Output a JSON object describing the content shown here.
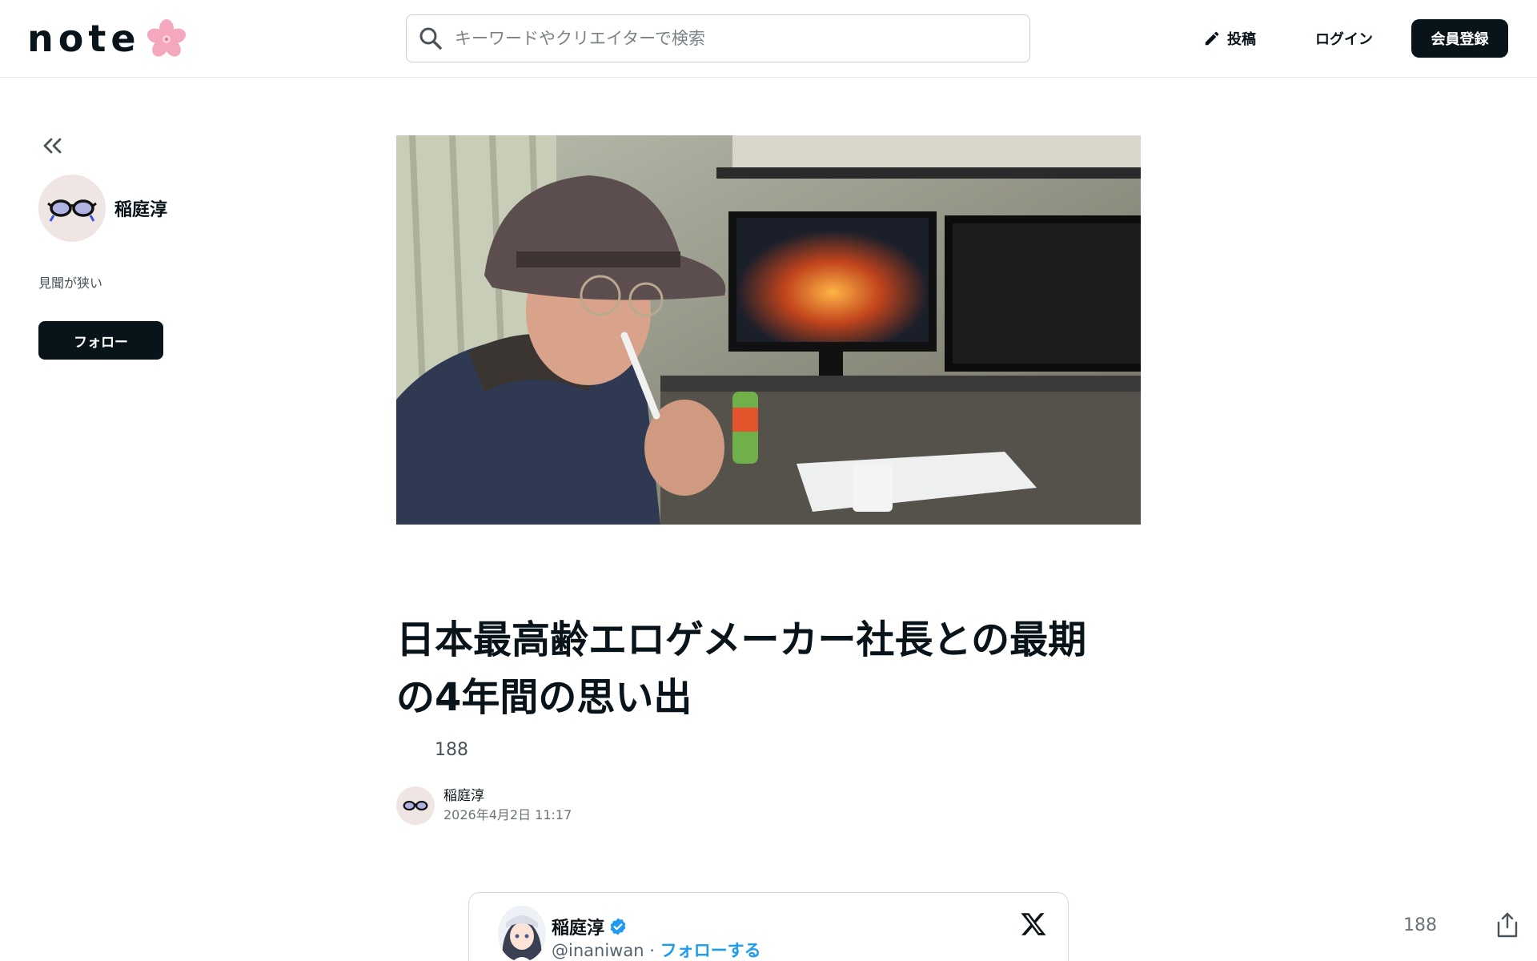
{
  "header": {
    "logo_text": "note",
    "search_placeholder": "キーワードやクリエイターで検索",
    "post_label": "投稿",
    "login_label": "ログイン",
    "signup_label": "会員登録"
  },
  "sidebar": {
    "creator_name": "稲庭淳",
    "bio": "見聞が狭い",
    "follow_label": "フォロー"
  },
  "article": {
    "title_line1": "日本最高齢エロゲメーカー社長との最期",
    "title_line2": "の4年間の思い出",
    "likes": "188",
    "author": "稲庭淳",
    "date": "2026年4月2日 11:17"
  },
  "tweet": {
    "name": "稲庭淳",
    "handle": "@inaniwan",
    "separator": "·",
    "follow_label": "フォローする"
  },
  "floating": {
    "likes": "188"
  },
  "colors": {
    "text": "#08131a",
    "accent_follow": "#1d9bf0",
    "verified": "#1d9bf0",
    "sakura": "#f4a7bd"
  }
}
